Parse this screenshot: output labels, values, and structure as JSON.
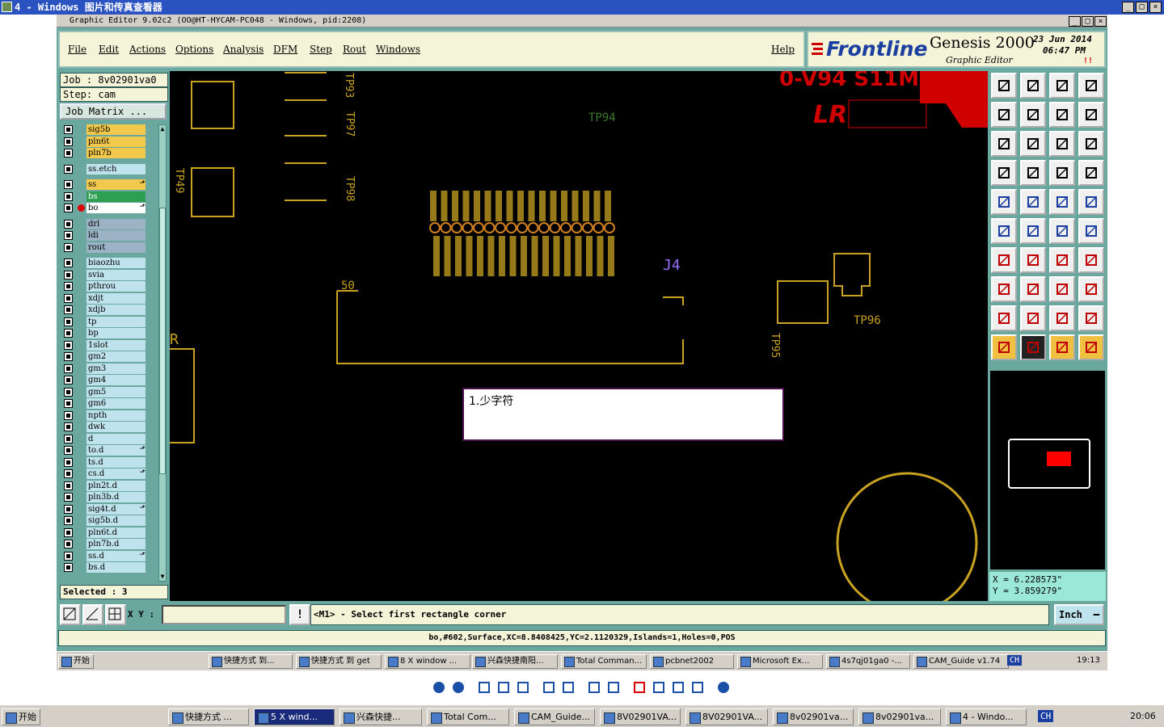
{
  "outer_window": {
    "title": "4 - Windows 图片和传真查看器",
    "controls": [
      "_",
      "□",
      "×"
    ]
  },
  "app": {
    "title": "Graphic Editor 9.02c2  (OO@HT-HYCAM-PC048 - Windows, pid:2208)",
    "controls": [
      "_",
      "□",
      "×"
    ],
    "menu": [
      "File",
      "Edit",
      "Actions",
      "Options",
      "Analysis",
      "DFM",
      "Step",
      "Rout",
      "Windows"
    ],
    "help": "Help",
    "brand": {
      "logo": "Frontline",
      "product": "Genesis 2000",
      "subtitle": "Graphic Editor",
      "date": "23  Jun  2014",
      "time": "06:47  PM",
      "mark": "!!"
    },
    "job": "Job  :  8v02901va0",
    "step": "Step:  cam",
    "job_matrix": "Job Matrix ...",
    "layers": [
      {
        "name": "sig5b",
        "color": "#f2c94c"
      },
      {
        "name": "pln6t",
        "color": "#f2c94c"
      },
      {
        "name": "pln7b",
        "color": "#f2c94c"
      },
      {
        "name": "ss.etch",
        "color": "#bfe3ec"
      },
      {
        "name": "ss",
        "color": "#f2c94c",
        "flag": "⬏"
      },
      {
        "name": "bs",
        "color": "#2e9e52"
      },
      {
        "name": "bo",
        "color": "#ffffff",
        "flag": "⬏",
        "active": true
      },
      {
        "name": "drl",
        "color": "#9bb3c4"
      },
      {
        "name": "ldi",
        "color": "#9bb3c4"
      },
      {
        "name": "rout",
        "color": "#9bb3c4"
      },
      {
        "name": "biaozhu",
        "color": "#bfe3ec"
      },
      {
        "name": "svia",
        "color": "#bfe3ec"
      },
      {
        "name": "pthrou",
        "color": "#bfe3ec"
      },
      {
        "name": "xdjt",
        "color": "#bfe3ec"
      },
      {
        "name": "xdjb",
        "color": "#bfe3ec"
      },
      {
        "name": "tp",
        "color": "#bfe3ec"
      },
      {
        "name": "bp",
        "color": "#bfe3ec"
      },
      {
        "name": "1slot",
        "color": "#bfe3ec"
      },
      {
        "name": "gm2",
        "color": "#bfe3ec"
      },
      {
        "name": "gm3",
        "color": "#bfe3ec"
      },
      {
        "name": "gm4",
        "color": "#bfe3ec"
      },
      {
        "name": "gm5",
        "color": "#bfe3ec"
      },
      {
        "name": "gm6",
        "color": "#bfe3ec"
      },
      {
        "name": "npth",
        "color": "#bfe3ec"
      },
      {
        "name": "dwk",
        "color": "#bfe3ec"
      },
      {
        "name": "d",
        "color": "#bfe3ec"
      },
      {
        "name": "to.d",
        "color": "#bfe3ec",
        "flag": "⬏"
      },
      {
        "name": "ts.d",
        "color": "#bfe3ec"
      },
      {
        "name": "cs.d",
        "color": "#bfe3ec",
        "flag": "⬏"
      },
      {
        "name": "pln2t.d",
        "color": "#bfe3ec"
      },
      {
        "name": "pln3b.d",
        "color": "#bfe3ec"
      },
      {
        "name": "sig4t.d",
        "color": "#bfe3ec",
        "flag": "⬏"
      },
      {
        "name": "sig5b.d",
        "color": "#bfe3ec"
      },
      {
        "name": "pln6t.d",
        "color": "#bfe3ec"
      },
      {
        "name": "pln7b.d",
        "color": "#bfe3ec"
      },
      {
        "name": "ss.d",
        "color": "#bfe3ec",
        "flag": "⬏"
      },
      {
        "name": "bs.d",
        "color": "#bfe3ec"
      }
    ],
    "selected": "Selected : 3",
    "canvas": {
      "note": "1.少字符",
      "labels": {
        "l50": "50",
        "tp94": "TP94",
        "tp95": "TP95",
        "tp96": "TP96",
        "tp93": "TP93",
        "tp97": "TP97",
        "tp98": "TP98",
        "tp49": "TP49",
        "j4": "J4",
        "lr": "LR",
        "wm": "0-V94 S11M",
        "r": "R"
      }
    },
    "coords": {
      "x": "X  =  6.228573\"",
      "y": "Y  =  3.859279\""
    },
    "cmd": {
      "xy_label": "X Y :",
      "xy_value": "",
      "prompt": "<M1> - Select first rectangle corner",
      "unit": "Inch"
    },
    "status": "bo,#602,Surface,XC=8.8408425,YC=2.1120329,Islands=1,Holes=0,POS",
    "taskbar": {
      "start": "开始",
      "items": [
        "快捷方式 到...",
        "快捷方式 到 get",
        "8 X window ...",
        "兴森快捷南阳...",
        "Total Comman...",
        "pcbnet2002",
        "Microsoft Ex...",
        "4s7qj01ga0 -...",
        "CAM_Guide v1.74"
      ],
      "lang": "CH",
      "clock": "19:13"
    }
  },
  "windows_taskbar": {
    "start": "开始",
    "items": [
      "快捷方式 ...",
      "5 X wind...",
      "兴森快捷...",
      "Total Com...",
      "CAM_Guide...",
      "8V02901VA...",
      "8V02901VA...",
      "8v02901va...",
      "8v02901va...",
      "4 - Windo..."
    ],
    "lang": "CH",
    "clock": "20:06"
  }
}
